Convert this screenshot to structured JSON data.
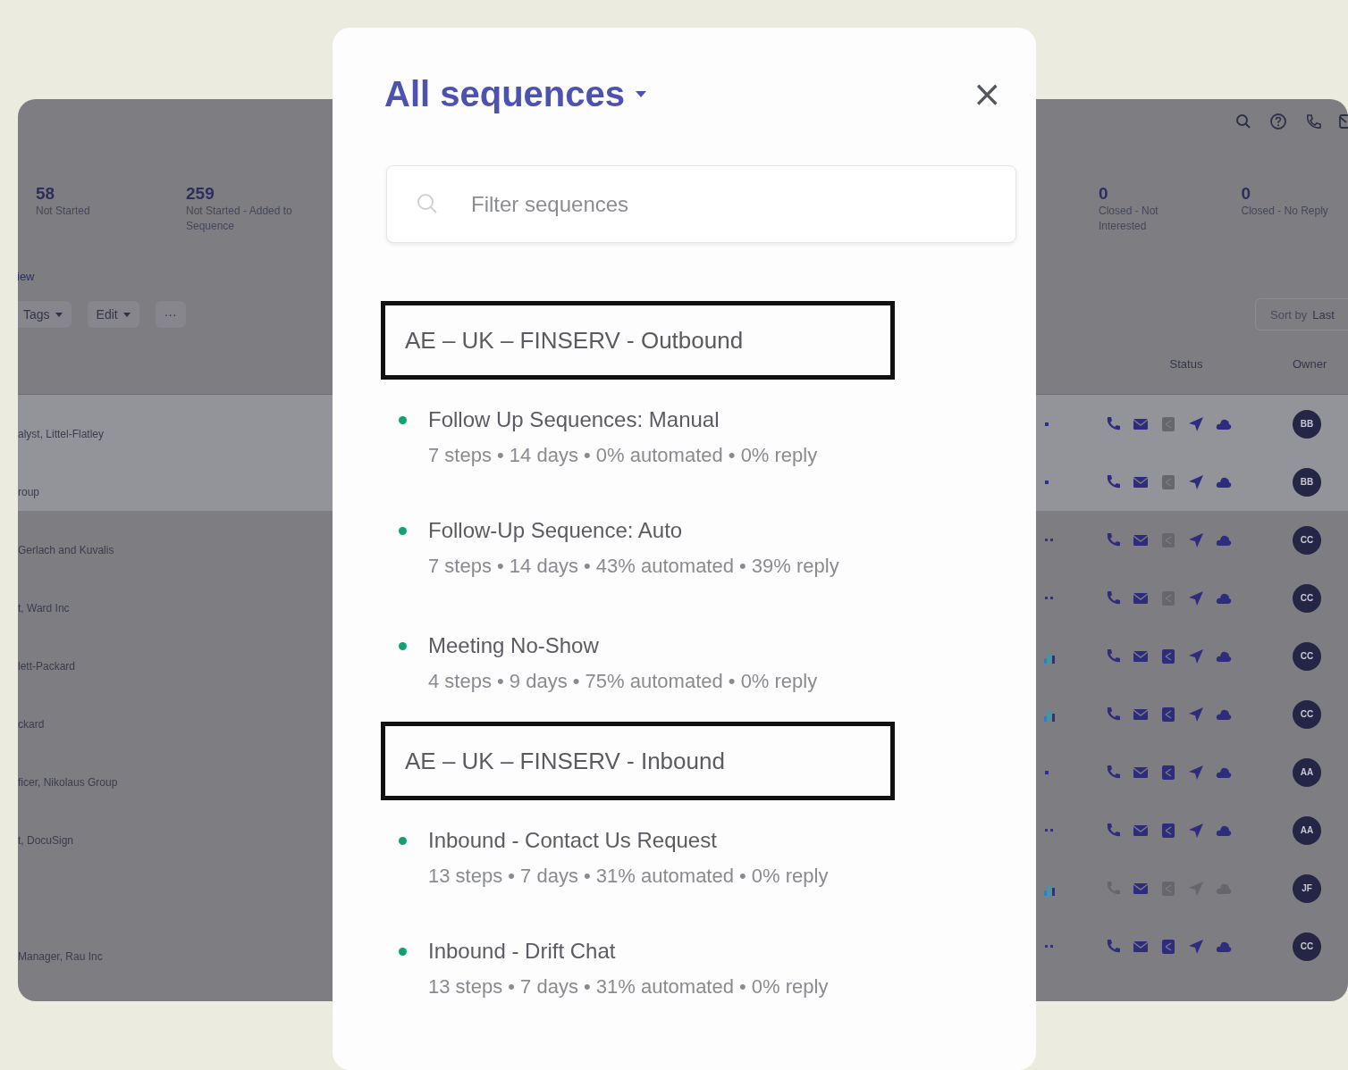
{
  "background_app": {
    "stats_left": [
      {
        "value": "58",
        "label": "Not Started"
      },
      {
        "value": "259",
        "label": "Not Started - Added to Sequence"
      }
    ],
    "stats_right": [
      {
        "value": "0",
        "label": "Closed - Not Interested"
      },
      {
        "value": "0",
        "label": "Closed - No Reply"
      }
    ],
    "view_label": "iew",
    "toolbar_buttons": [
      {
        "label": "Tags",
        "dropdown": true
      },
      {
        "label": "Edit",
        "dropdown": true
      },
      {
        "label": "···",
        "dropdown": false
      }
    ],
    "sort": {
      "label": "Sort by",
      "value": "Last"
    },
    "table": {
      "columns": [
        "Status",
        "Owner"
      ],
      "rows": [
        {
          "cell_text": "alyst, Littel-Flatley",
          "selected": true,
          "kind": "dot",
          "channels": [
            true,
            true,
            false,
            true,
            true
          ],
          "owner": "BB"
        },
        {
          "cell_text": "roup",
          "selected": true,
          "kind": "dot",
          "channels": [
            true,
            true,
            false,
            true,
            true
          ],
          "owner": "BB"
        },
        {
          "cell_text": "Gerlach and Kuvalis",
          "selected": false,
          "kind": "dots",
          "channels": [
            true,
            true,
            false,
            true,
            true
          ],
          "owner": "CC"
        },
        {
          "cell_text": "t, Ward Inc",
          "selected": false,
          "kind": "dots",
          "channels": [
            true,
            true,
            false,
            true,
            true
          ],
          "owner": "CC"
        },
        {
          "cell_text": "lett-Packard",
          "selected": false,
          "kind": "bars",
          "channels": [
            true,
            true,
            true,
            true,
            true
          ],
          "owner": "CC"
        },
        {
          "cell_text": "ckard",
          "selected": false,
          "kind": "bars",
          "channels": [
            true,
            true,
            true,
            true,
            true
          ],
          "owner": "CC"
        },
        {
          "cell_text": "ficer, Nikolaus Group",
          "selected": false,
          "kind": "dot",
          "channels": [
            true,
            true,
            true,
            true,
            true
          ],
          "owner": "AA"
        },
        {
          "cell_text": "t, DocuSign",
          "selected": false,
          "kind": "dots",
          "channels": [
            true,
            true,
            true,
            true,
            true
          ],
          "owner": "AA"
        },
        {
          "selected": false,
          "kind": "bars",
          "channels": [
            false,
            true,
            false,
            false,
            false
          ],
          "owner": "JF"
        },
        {
          "cell_text": "Manager, Rau Inc",
          "selected": false,
          "kind": "dots",
          "channels": [
            true,
            true,
            true,
            true,
            true
          ],
          "owner": "CC"
        }
      ]
    }
  },
  "modal": {
    "title": "All sequences",
    "close": "×",
    "filter": {
      "placeholder": "Filter sequences"
    },
    "groups": [
      {
        "name": "AE – UK – FINSERV - Outbound",
        "highlighted": true,
        "sequences": [
          {
            "name": "Follow Up Sequences: Manual",
            "meta": "7 steps • 14 days • 0% automated • 0% reply",
            "active": true
          },
          {
            "name": "Follow-Up Sequence: Auto",
            "meta": "7 steps • 14 days • 43% automated • 39% reply",
            "active": true
          },
          {
            "name": "Meeting No-Show",
            "meta": "4 steps • 9 days • 75% automated • 0% reply",
            "active": true
          }
        ]
      },
      {
        "name": "AE – UK – FINSERV - Inbound",
        "highlighted": true,
        "sequences": [
          {
            "name": "Inbound - Contact Us Request",
            "meta": "13 steps • 7 days • 31% automated • 0% reply",
            "active": true
          },
          {
            "name": "Inbound - Drift Chat",
            "meta": "13 steps • 7 days • 31% automated • 0% reply",
            "active": true
          }
        ]
      }
    ]
  }
}
